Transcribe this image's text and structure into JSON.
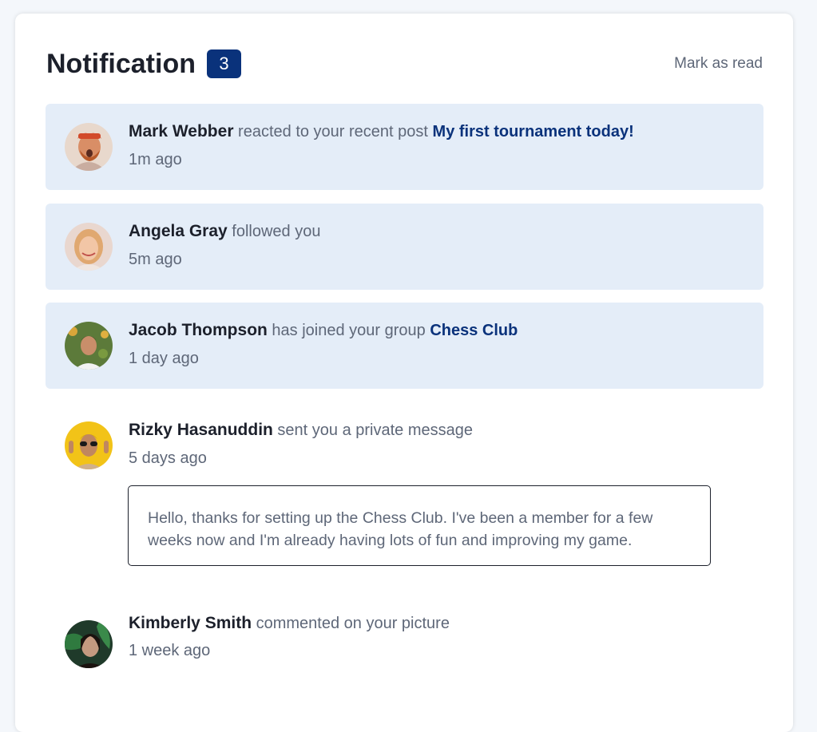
{
  "header": {
    "title": "Notification",
    "badge_count": "3",
    "mark_read_label": "Mark as read"
  },
  "notifications": [
    {
      "user": "Mark Webber",
      "action": " reacted to your recent post ",
      "target": "My first tournament today!",
      "time": "1m ago",
      "unread": true
    },
    {
      "user": "Angela Gray",
      "action": " followed you",
      "target": "",
      "time": "5m ago",
      "unread": true
    },
    {
      "user": "Jacob Thompson",
      "action": " has joined your group ",
      "target": "Chess Club",
      "time": "1 day ago",
      "unread": true
    },
    {
      "user": "Rizky Hasanuddin",
      "action": " sent you a private message",
      "target": "",
      "time": "5 days ago",
      "unread": false,
      "message": "Hello, thanks for setting up the Chess Club. I've been a member for a few weeks now and I'm already having lots of fun and improving my game."
    },
    {
      "user": "Kimberly Smith",
      "action": " commented on your picture",
      "target": "",
      "time": "1 week ago",
      "unread": false
    }
  ],
  "colors": {
    "accent": "#0a327b",
    "unread_bg": "#e4edf8",
    "text_dark": "#1c202b",
    "text_muted": "#5e6778"
  }
}
